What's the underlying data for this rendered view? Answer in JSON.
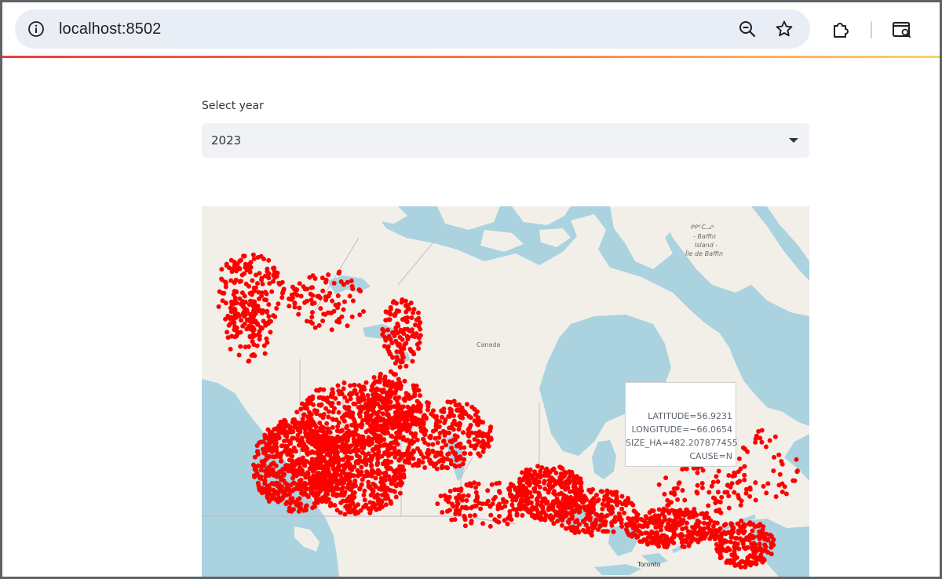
{
  "browser": {
    "url": "localhost:8502"
  },
  "app": {
    "select_label": "Select year",
    "select_value": "2023"
  },
  "map": {
    "labels": {
      "baffin_1": "ᑭᑭᑦᑖᓗᒃ",
      "baffin_2": "- Baffin",
      "baffin_3": "Island -",
      "baffin_4": "Île de Baffin",
      "canada": "Canada",
      "toronto": "Toronto"
    },
    "marker_color": "#ff0000",
    "tooltip": {
      "latitude": "LATITUDE=56.9231",
      "longitude": "LONGITUDE=−66.0654",
      "size": "SIZE_HA=482.207877455",
      "cause": "CAUSE=N"
    }
  },
  "colors": {
    "water": "#aad3df",
    "land": "#f2efe9",
    "accent_line": "#f03c3c"
  }
}
